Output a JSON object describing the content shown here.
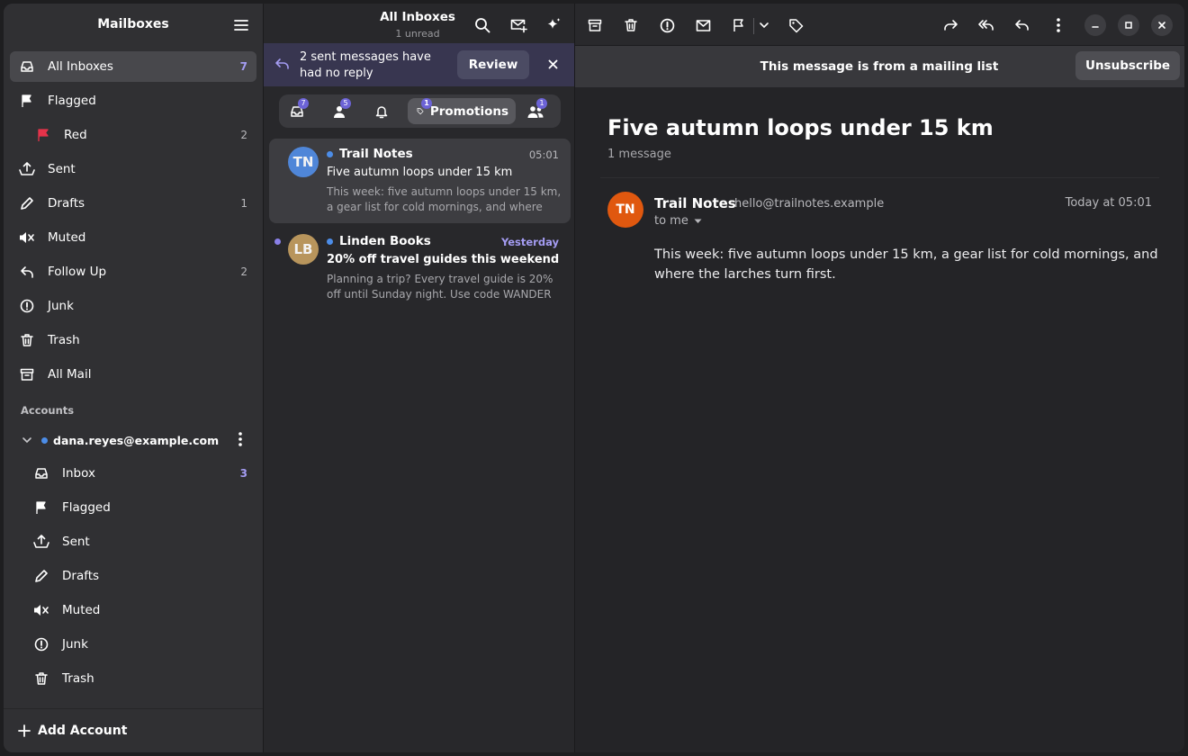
{
  "sidebar": {
    "title": "Mailboxes",
    "items": [
      {
        "label": "All Inboxes",
        "count": "7",
        "icon": "inbox-icon"
      },
      {
        "label": "Flagged",
        "count": "",
        "icon": "flag-icon"
      },
      {
        "label": "Red",
        "count": "2",
        "icon": "red-flag-icon"
      },
      {
        "label": "Sent",
        "count": "",
        "icon": "sent-icon"
      },
      {
        "label": "Drafts",
        "count": "1",
        "icon": "pencil-icon"
      },
      {
        "label": "Muted",
        "count": "",
        "icon": "muted-icon"
      },
      {
        "label": "Follow Up",
        "count": "2",
        "icon": "reply-icon"
      },
      {
        "label": "Junk",
        "count": "",
        "icon": "alert-icon"
      },
      {
        "label": "Trash",
        "count": "",
        "icon": "trash-icon"
      },
      {
        "label": "All Mail",
        "count": "",
        "icon": "archive-icon"
      }
    ],
    "accounts_header": "Accounts",
    "account": {
      "email": "dana.reyes@example.com",
      "items": [
        {
          "label": "Inbox",
          "count": "3"
        },
        {
          "label": "Flagged",
          "count": ""
        },
        {
          "label": "Sent",
          "count": ""
        },
        {
          "label": "Drafts",
          "count": ""
        },
        {
          "label": "Muted",
          "count": ""
        },
        {
          "label": "Junk",
          "count": ""
        },
        {
          "label": "Trash",
          "count": ""
        }
      ]
    },
    "add_account": "Add Account"
  },
  "message_list": {
    "title": "All Inboxes",
    "subtitle": "1 unread",
    "banner": {
      "text": "2 sent messages have had no reply",
      "button": "Review"
    },
    "filters": [
      {
        "icon": "inbox-icon",
        "badge": "7"
      },
      {
        "icon": "person-icon",
        "badge": "5"
      },
      {
        "icon": "bell-icon",
        "badge": ""
      },
      {
        "icon": "tag-icon",
        "badge": "1",
        "label": "Promotions"
      },
      {
        "icon": "people-icon",
        "badge": "1"
      }
    ],
    "messages": [
      {
        "initials": "TN",
        "sender": "Trail Notes",
        "time": "05:01",
        "subject": "Five autumn loops under 15 km",
        "preview": "This week: five autumn loops under 15 km, a gear list for cold mornings, and where the larches turn first."
      },
      {
        "initials": "LB",
        "sender": "Linden Books",
        "time": "Yesterday",
        "subject": "20% off travel guides this weekend",
        "preview": "Planning a trip? Every travel guide is 20% off until Sunday night. Use code WANDER at checkout."
      }
    ]
  },
  "reader": {
    "mailing_list_notice": "This message is from a mailing list",
    "unsubscribe": "Unsubscribe",
    "thread_title": "Five autumn loops under 15 km",
    "thread_count": "1 message",
    "message": {
      "initials": "TN",
      "sender": "Trail Notes",
      "email": "hello@trailnotes.example",
      "to": "to me",
      "time": "Today at 05:01",
      "body": "This week: five autumn loops under 15 km, a gear list for cold mornings, and where the larches turn first."
    }
  },
  "colors": {
    "accent": "#6c63d6",
    "unread_dot": "#4c8de8",
    "sender_avatar": "#e0580f",
    "red_flag": "#e5334a"
  }
}
